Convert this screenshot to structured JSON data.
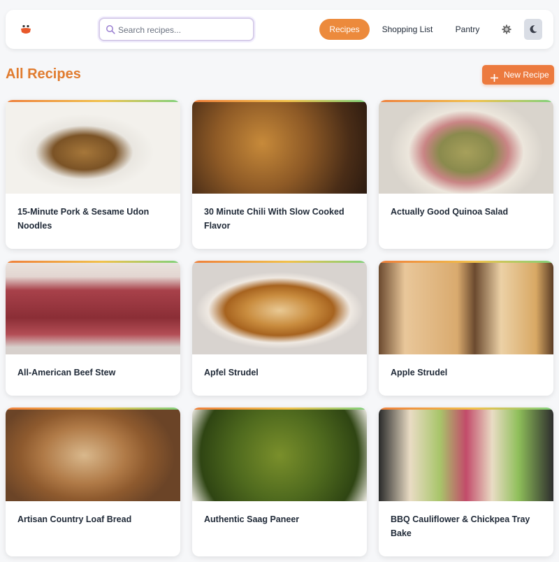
{
  "nav": {
    "logo_icon": "chef-hat-logo-icon",
    "search": {
      "placeholder": "Search recipes...",
      "value": ""
    },
    "links": [
      {
        "label": "Recipes",
        "active": true
      },
      {
        "label": "Shopping List",
        "active": false
      },
      {
        "label": "Pantry",
        "active": false
      }
    ],
    "settings_icon": "gear-icon",
    "theme_icon": "moon-icon"
  },
  "page": {
    "title": "All Recipes",
    "new_button_label": "New Recipe"
  },
  "colors": {
    "accent": "#ec8a3c",
    "title": "#e07b2e",
    "background": "#f6f7f9"
  },
  "recipes": [
    {
      "title": "15-Minute Pork & Sesame Udon Noodles"
    },
    {
      "title": "30 Minute Chili With Slow Cooked Flavor"
    },
    {
      "title": "Actually Good Quinoa Salad"
    },
    {
      "title": "All-American Beef Stew"
    },
    {
      "title": "Apfel Strudel"
    },
    {
      "title": "Apple Strudel"
    },
    {
      "title": "Artisan Country Loaf Bread"
    },
    {
      "title": "Authentic Saag Paneer"
    },
    {
      "title": "BBQ Cauliflower & Chickpea Tray Bake"
    }
  ]
}
